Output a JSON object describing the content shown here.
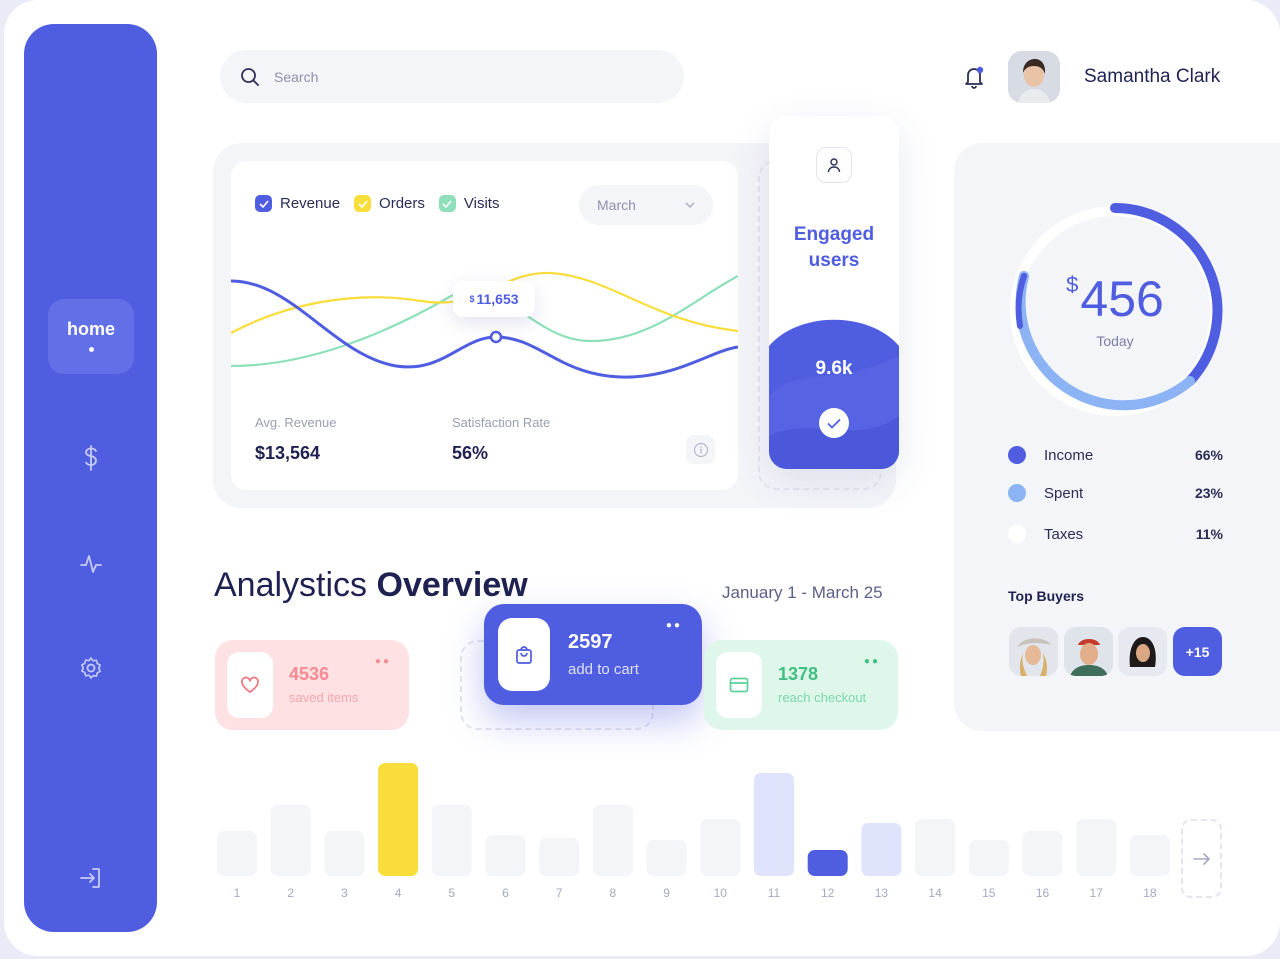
{
  "sidebar": {
    "items": [
      {
        "label": "home",
        "icon": "home",
        "active": true
      },
      {
        "label": "",
        "icon": "dollar-icon"
      },
      {
        "label": "",
        "icon": "activity-icon"
      },
      {
        "label": "",
        "icon": "gear-icon"
      },
      {
        "label": "",
        "icon": "logout-icon"
      }
    ]
  },
  "header": {
    "search_placeholder": "Search",
    "user_name": "Samantha Clark"
  },
  "chart_card": {
    "legend": [
      "Revenue",
      "Orders",
      "Visits"
    ],
    "month": "March",
    "tooltip_currency": "$",
    "tooltip_value": "11,653",
    "avg_revenue_label": "Avg. Revenue",
    "avg_revenue_value": "$13,564",
    "satisfaction_label": "Satisfaction Rate",
    "satisfaction_value": "56%"
  },
  "engaged": {
    "title_line1": "Engaged",
    "title_line2": "users",
    "count": "9.6k"
  },
  "today": {
    "currency": "$",
    "amount": "456",
    "label": "Today",
    "breakdown": [
      {
        "name": "Income",
        "pct": "66%",
        "color": "#4f5de0"
      },
      {
        "name": "Spent",
        "pct": "23%",
        "color": "#8cb4f5"
      },
      {
        "name": "Taxes",
        "pct": "11%",
        "color": "#ffffff"
      }
    ],
    "top_buyers_label": "Top Buyers",
    "more_buyers": "+15"
  },
  "analytics": {
    "title_regular": "Analystics",
    "title_bold": "Overview",
    "date_range": "January 1 - March 25",
    "cards": [
      {
        "value": "4536",
        "label": "saved items"
      },
      {
        "value": "2597",
        "label": "add to cart"
      },
      {
        "value": "1378",
        "label": "reach checkout"
      }
    ]
  },
  "colors": {
    "accent": "#4f5de0",
    "yellow": "#f9dd3a",
    "green": "#8de0b9",
    "pink": "#fde1e3",
    "light_blue": "#8cb4f5"
  },
  "chart_data": {
    "type": "bar",
    "categories": [
      "1",
      "2",
      "3",
      "4",
      "5",
      "6",
      "7",
      "8",
      "9",
      "10",
      "11",
      "12",
      "13",
      "14",
      "15",
      "16",
      "17",
      "18"
    ],
    "values": [
      45,
      71,
      45,
      113,
      71,
      41,
      38,
      71,
      36,
      57,
      103,
      26,
      53,
      57,
      36,
      45,
      57,
      41
    ],
    "highlight": {
      "4": "yellow",
      "11": "light-indigo",
      "12": "indigo",
      "13": "light-indigo"
    }
  }
}
